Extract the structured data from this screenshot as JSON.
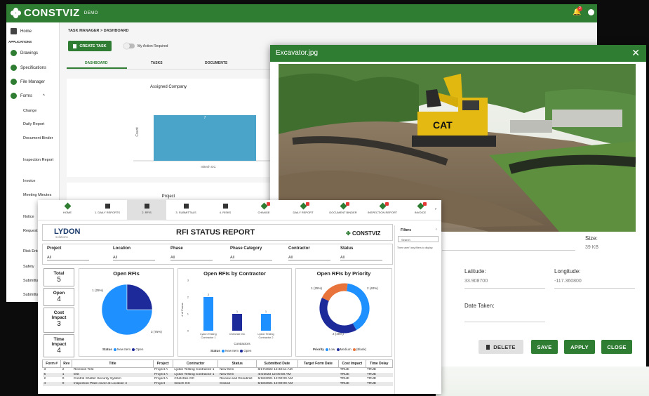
{
  "app": {
    "brand": "CONSTVIZ",
    "env": "DEMO",
    "notif_count": "2"
  },
  "sidebar": {
    "home": "Home",
    "section": "APPLICATIONS",
    "items": [
      "Drawings",
      "Specifications",
      "File Manager",
      "Forms"
    ],
    "sub_items": [
      "Change",
      "Daily Report",
      "Document Binder",
      "Inspection Report",
      "Invoice",
      "Meeting Minutes",
      "Notice",
      "Request Information",
      "Risk Entry",
      "Safety",
      "Submittal",
      "Submittal Extension"
    ]
  },
  "task_manager": {
    "breadcrumb": "TASK MANAGER > DASHBOARD",
    "create_btn": "CREATE TASK",
    "toggle_label": "My Action Required",
    "tabs": [
      "DASHBOARD",
      "TASKS",
      "DOCUMENTS"
    ],
    "chart_title": "Assigned Company",
    "y_label": "Count",
    "bar_value": "7",
    "category": "Initech GC",
    "project_title": "Project"
  },
  "dialog": {
    "title": "Excavator.jpg",
    "close": "✕",
    "size_label": "Size:",
    "size_value": "39 KB",
    "lat_label": "Latitude:",
    "lat_value": "33.908700",
    "lon_label": "Longitude:",
    "lon_value": "-117.360800",
    "date_label": "Date Taken:",
    "buttons": {
      "delete": "DELETE",
      "save": "SAVE",
      "apply": "APPLY",
      "close": "CLOSE"
    }
  },
  "rfi_nav": [
    "HOME",
    "1. DAILY REPORTS",
    "2. RFIS",
    "3. SUBMITTALS",
    "4. RISKS",
    "CHANGE",
    "DAILY REPORT",
    "DOCUMENT BINDER",
    "INSPECTION REPORT",
    "INVOICE"
  ],
  "rfi": {
    "logo": "LYDON",
    "logo_sub": "solutions",
    "title": "RFI STATUS REPORT",
    "cv_logo": "CONSTVIZ",
    "filters": [
      {
        "label": "Project",
        "value": "All"
      },
      {
        "label": "Location",
        "value": "All"
      },
      {
        "label": "Phase",
        "value": "All"
      },
      {
        "label": "Phase Category",
        "value": "All"
      },
      {
        "label": "Contractor",
        "value": "All"
      },
      {
        "label": "Status",
        "value": "All"
      }
    ],
    "kpis": [
      {
        "label": "Total",
        "value": "5"
      },
      {
        "label": "Open",
        "value": "4"
      },
      {
        "label": "Cost Impact",
        "value": "3"
      },
      {
        "label": "Time Impact",
        "value": "4"
      }
    ],
    "pie_title": "Open RFIs",
    "pie_labels": [
      "1 (25%)",
      "3 (75%)"
    ],
    "pie_legend": {
      "prefix": "Status",
      "a": "New Item",
      "b": "Open"
    },
    "bar_title": "Open RFIs by Contractor",
    "bar_ylabel": "# of Forms",
    "bar_xlabel": "Contractors",
    "bar_legend": {
      "prefix": "Status",
      "a": "New Item",
      "b": "Open"
    },
    "donut_title": "Open RFIs by Priority",
    "donut_labels": [
      "1 (25%)",
      "2 (40%)",
      "2 (40%)"
    ],
    "donut_legend": {
      "prefix": "Priority",
      "a": "Low",
      "b": "Medium",
      "c": "(Blank)"
    },
    "table_headers": [
      "Form #",
      "Rev",
      "Title",
      "Project",
      "Contractor",
      "Status",
      "Submitted Date",
      "Target Form Date",
      "Cost Impact",
      "Time Delay"
    ],
    "table_rows": [
      [
        "3",
        "2",
        "Revision Test",
        "Project A",
        "Lydon Testing Contractor 1",
        "New Item",
        "8/17/2022 12:32:11 AM",
        "",
        "TRUE",
        "TRUE"
      ],
      [
        "5",
        "1",
        "test",
        "Project A",
        "Lydon Testing Contractor 1",
        "New Item",
        "4/4/2023 12:00:00 AM",
        "",
        "TRUE",
        "TRUE"
      ],
      [
        "2",
        "0",
        "Control Shelter Security System",
        "Project A",
        "Chetchke GC",
        "Review and Resubmit",
        "5/18/2021 12:00:00 AM",
        "",
        "TRUE",
        "TRUE"
      ],
      [
        "4",
        "0",
        "Inspection Plate cover at Location 4",
        "Project",
        "Initech GC",
        "Closed",
        "5/18/2021 12:00:00 AM",
        "",
        "TRUE",
        "TRUE"
      ]
    ]
  },
  "filters_pane": {
    "title": "Filters",
    "search": "Search",
    "message": "There aren't any filters to display."
  },
  "chart_data": [
    {
      "type": "bar",
      "title": "Assigned Company",
      "ylabel": "Count",
      "categories": [
        "Initech GC"
      ],
      "values": [
        7
      ]
    },
    {
      "type": "pie",
      "title": "Open RFIs",
      "categories": [
        "New Item",
        "Open"
      ],
      "values": [
        1,
        3
      ]
    },
    {
      "type": "bar",
      "title": "Open RFIs by Contractor",
      "xlabel": "Contractors",
      "ylabel": "# of Forms",
      "categories": [
        "Lydon Testing Contractor 1",
        "Chetchke GC",
        "Lydon Testing Contractor 2"
      ],
      "series": [
        {
          "name": "New Item",
          "values": [
            2,
            0,
            1
          ]
        },
        {
          "name": "Open",
          "values": [
            0,
            1,
            0
          ]
        }
      ],
      "ylim": [
        0,
        3
      ]
    },
    {
      "type": "pie",
      "title": "Open RFIs by Priority",
      "categories": [
        "Low",
        "Medium",
        "(Blank)"
      ],
      "values": [
        1,
        2,
        2
      ]
    }
  ],
  "colors": {
    "brand_green": "#2e7d32",
    "light_blue": "#1e90ff",
    "dark_blue": "#1c2b99",
    "orange": "#e8743b"
  }
}
